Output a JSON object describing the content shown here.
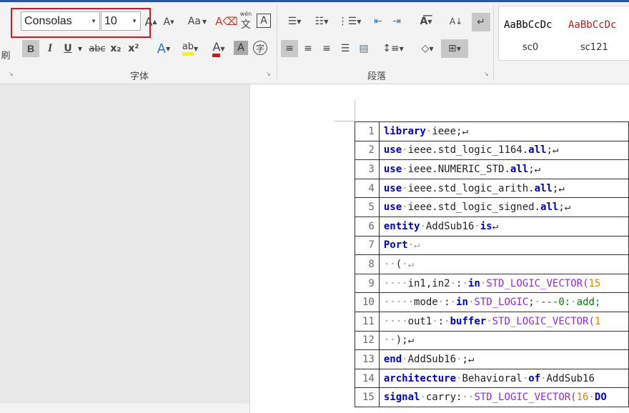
{
  "ribbon": {
    "cut_label": "刷",
    "font_name": "Consolas",
    "font_size": "10",
    "change_case_label": "Aa",
    "phonetic_label": "wén",
    "phonetic_char": "文",
    "border_char": "A",
    "bold": "B",
    "italic": "I",
    "underline": "U",
    "strike": "abc",
    "subscript": "x₂",
    "superscript": "x²",
    "font_group_label": "字体",
    "paragraph_group_label": "段落",
    "styles": [
      {
        "preview": "AaBbCcDc",
        "name": "sc0",
        "color": "#222222"
      },
      {
        "preview": "AaBbCcDc",
        "name": "sc121",
        "color": "#b02020"
      }
    ]
  },
  "document": {
    "lines": [
      {
        "num": "1",
        "tokens": [
          {
            "t": "library",
            "c": "kw"
          },
          {
            "t": "·",
            "c": "dot"
          },
          {
            "t": "ieee",
            "c": "pl"
          },
          {
            "t": ";↵",
            "c": "pl"
          }
        ]
      },
      {
        "num": "2",
        "tokens": [
          {
            "t": "use",
            "c": "kw"
          },
          {
            "t": "·",
            "c": "dot"
          },
          {
            "t": "ieee.std_logic_1164.",
            "c": "pl"
          },
          {
            "t": "all",
            "c": "kw"
          },
          {
            "t": ";↵",
            "c": "pl"
          }
        ]
      },
      {
        "num": "3",
        "tokens": [
          {
            "t": "use",
            "c": "kw"
          },
          {
            "t": "·",
            "c": "dot"
          },
          {
            "t": "ieee.NUMERIC_STD.",
            "c": "pl"
          },
          {
            "t": "all",
            "c": "kw"
          },
          {
            "t": ";↵",
            "c": "pl"
          }
        ]
      },
      {
        "num": "4",
        "tokens": [
          {
            "t": "use",
            "c": "kw"
          },
          {
            "t": "·",
            "c": "dot"
          },
          {
            "t": "ieee.std_logic_arith.",
            "c": "pl"
          },
          {
            "t": "all",
            "c": "kw"
          },
          {
            "t": ";↵",
            "c": "pl"
          }
        ]
      },
      {
        "num": "5",
        "tokens": [
          {
            "t": "use",
            "c": "kw"
          },
          {
            "t": "·",
            "c": "dot"
          },
          {
            "t": "ieee.std_logic_signed.",
            "c": "pl"
          },
          {
            "t": "all",
            "c": "kw"
          },
          {
            "t": ";↵",
            "c": "pl"
          }
        ]
      },
      {
        "num": "6",
        "tokens": [
          {
            "t": "entity",
            "c": "kw"
          },
          {
            "t": "·",
            "c": "dot"
          },
          {
            "t": "AddSub16",
            "c": "pl"
          },
          {
            "t": "·",
            "c": "dot"
          },
          {
            "t": "is",
            "c": "kw"
          },
          {
            "t": "↵",
            "c": "pl"
          }
        ]
      },
      {
        "num": "7",
        "tokens": [
          {
            "t": "Port",
            "c": "kw"
          },
          {
            "t": "·↵",
            "c": "dot"
          }
        ]
      },
      {
        "num": "8",
        "tokens": [
          {
            "t": "··",
            "c": "dot"
          },
          {
            "t": "(",
            "c": "pl"
          },
          {
            "t": "·↵",
            "c": "dot"
          }
        ]
      },
      {
        "num": "9",
        "tokens": [
          {
            "t": "····",
            "c": "dot"
          },
          {
            "t": "in1,in2",
            "c": "pl"
          },
          {
            "t": "·",
            "c": "dot"
          },
          {
            "t": ":",
            "c": "pl"
          },
          {
            "t": "·",
            "c": "dot"
          },
          {
            "t": "in",
            "c": "kw"
          },
          {
            "t": "·",
            "c": "dot"
          },
          {
            "t": "STD_LOGIC_VECTOR(",
            "c": "ty"
          },
          {
            "t": "15",
            "c": "nm"
          }
        ]
      },
      {
        "num": "10",
        "tokens": [
          {
            "t": "·····",
            "c": "dot"
          },
          {
            "t": "mode",
            "c": "pl"
          },
          {
            "t": "·",
            "c": "dot"
          },
          {
            "t": ":",
            "c": "pl"
          },
          {
            "t": "·",
            "c": "dot"
          },
          {
            "t": "in",
            "c": "kw"
          },
          {
            "t": "·",
            "c": "dot"
          },
          {
            "t": "STD_LOGIC",
            "c": "ty"
          },
          {
            "t": ";",
            "c": "pl"
          },
          {
            "t": "·",
            "c": "dot"
          },
          {
            "t": "---0:",
            "c": "cm"
          },
          {
            "t": "·",
            "c": "dot"
          },
          {
            "t": "add;",
            "c": "cm"
          }
        ]
      },
      {
        "num": "11",
        "tokens": [
          {
            "t": "····",
            "c": "dot"
          },
          {
            "t": "out1",
            "c": "pl"
          },
          {
            "t": "·",
            "c": "dot"
          },
          {
            "t": ":",
            "c": "pl"
          },
          {
            "t": "·",
            "c": "dot"
          },
          {
            "t": "buffer",
            "c": "kw"
          },
          {
            "t": "·",
            "c": "dot"
          },
          {
            "t": "STD_LOGIC_VECTOR(",
            "c": "ty"
          },
          {
            "t": "1",
            "c": "nm"
          }
        ]
      },
      {
        "num": "12",
        "tokens": [
          {
            "t": "··",
            "c": "dot"
          },
          {
            "t": ");",
            "c": "pl"
          },
          {
            "t": "↵",
            "c": "pl"
          }
        ]
      },
      {
        "num": "13",
        "tokens": [
          {
            "t": "end",
            "c": "kw"
          },
          {
            "t": "·",
            "c": "dot"
          },
          {
            "t": "AddSub16",
            "c": "pl"
          },
          {
            "t": "·",
            "c": "dot"
          },
          {
            "t": ";↵",
            "c": "pl"
          }
        ]
      },
      {
        "num": "14",
        "tokens": [
          {
            "t": "architecture",
            "c": "kw"
          },
          {
            "t": "·",
            "c": "dot"
          },
          {
            "t": "Behavioral",
            "c": "pl"
          },
          {
            "t": "·",
            "c": "dot"
          },
          {
            "t": "of",
            "c": "kw"
          },
          {
            "t": "·",
            "c": "dot"
          },
          {
            "t": "AddSub16",
            "c": "pl"
          }
        ]
      },
      {
        "num": "15",
        "tokens": [
          {
            "t": "signal",
            "c": "kw"
          },
          {
            "t": "·",
            "c": "dot"
          },
          {
            "t": "carry:",
            "c": "pl"
          },
          {
            "t": "··",
            "c": "dot"
          },
          {
            "t": "STD_LOGIC_VECTOR(",
            "c": "ty"
          },
          {
            "t": "16",
            "c": "nm"
          },
          {
            "t": "·",
            "c": "dot"
          },
          {
            "t": "DO",
            "c": "kw"
          }
        ]
      }
    ]
  }
}
